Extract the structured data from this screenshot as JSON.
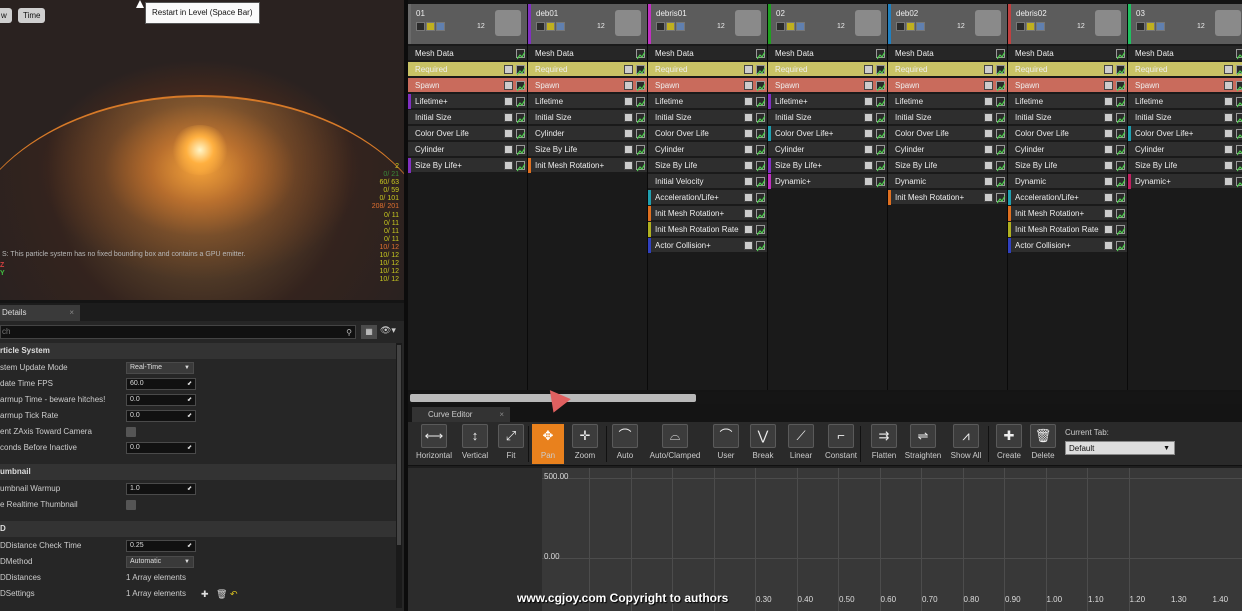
{
  "viewport": {
    "buttons": [
      "w",
      "Time"
    ],
    "tooltip": "Restart in Level (Space Bar)",
    "warning": "S: This particle system has no fixed bounding box and contains a GPU emitter.",
    "axis_z": "Z",
    "axis_y": "Y",
    "stats": [
      {
        "text": "2",
        "color": "#c8c820"
      },
      {
        "text": "0/ 21",
        "color": "#3a8a3a"
      },
      {
        "text": "60/ 63",
        "color": "#c8c820"
      },
      {
        "text": "0/ 59",
        "color": "#c8c820"
      },
      {
        "text": "0/ 101",
        "color": "#c8c820"
      },
      {
        "text": "208/ 201",
        "color": "#e07030"
      },
      {
        "text": "0/ 11",
        "color": "#c8c820"
      },
      {
        "text": "0/ 11",
        "color": "#c8c820"
      },
      {
        "text": "0/ 11",
        "color": "#c8c820"
      },
      {
        "text": "0/ 11",
        "color": "#c8c820"
      },
      {
        "text": "10/ 12",
        "color": "#e07030"
      },
      {
        "text": "10/ 12",
        "color": "#c8c820"
      },
      {
        "text": "10/ 12",
        "color": "#c8c820"
      },
      {
        "text": "10/ 12",
        "color": "#c8c820"
      },
      {
        "text": "10/ 12",
        "color": "#c8c820"
      }
    ]
  },
  "details": {
    "tab": "Details",
    "search_placeholder": "ch",
    "sections": [
      {
        "title": "rticle System",
        "rows": [
          {
            "label": "stem Update Mode",
            "kind": "dropdown",
            "value": "Real-Time"
          },
          {
            "label": "date Time FPS",
            "kind": "number",
            "value": "60.0"
          },
          {
            "label": "armup Time - beware hitches!",
            "kind": "number",
            "value": "0.0"
          },
          {
            "label": "armup Tick Rate",
            "kind": "number",
            "value": "0.0"
          },
          {
            "label": "ent ZAxis Toward Camera",
            "kind": "check",
            "value": ""
          },
          {
            "label": "conds Before Inactive",
            "kind": "number",
            "value": "0.0"
          }
        ]
      },
      {
        "title": "umbnail",
        "rows": [
          {
            "label": "umbnail Warmup",
            "kind": "number",
            "value": "1.0"
          },
          {
            "label": "e Realtime Thumbnail",
            "kind": "check",
            "value": ""
          }
        ]
      },
      {
        "title": "D",
        "rows": [
          {
            "label": "DDistance Check Time",
            "kind": "number",
            "value": "0.25"
          },
          {
            "label": "DMethod",
            "kind": "dropdown",
            "value": "Automatic"
          },
          {
            "label": "DDistances",
            "kind": "array",
            "value": "1 Array elements"
          },
          {
            "label": "DSettings",
            "kind": "array",
            "value": "1 Array elements"
          }
        ]
      }
    ]
  },
  "emitters": [
    {
      "name": "01",
      "count": "12",
      "accent": "#6a6a6a",
      "modules": [
        {
          "label": "Mesh Data",
          "type": "plain",
          "bar": ""
        },
        {
          "label": "Required",
          "type": "req",
          "bar": ""
        },
        {
          "label": "Spawn",
          "type": "spawn",
          "bar": ""
        },
        {
          "label": "Lifetime+",
          "type": "mod",
          "bar": "#8030c0"
        },
        {
          "label": "Initial Size",
          "type": "mod",
          "bar": ""
        },
        {
          "label": "Color Over Life",
          "type": "mod",
          "bar": ""
        },
        {
          "label": "Cylinder",
          "type": "mod",
          "bar": ""
        },
        {
          "label": "Size By Life+",
          "type": "mod",
          "bar": "#8030c0"
        }
      ]
    },
    {
      "name": "deb01",
      "count": "12",
      "accent": "#8030c0",
      "modules": [
        {
          "label": "Mesh Data",
          "type": "plain",
          "bar": ""
        },
        {
          "label": "Required",
          "type": "req",
          "bar": ""
        },
        {
          "label": "Spawn",
          "type": "spawn",
          "bar": ""
        },
        {
          "label": "Lifetime",
          "type": "mod",
          "bar": ""
        },
        {
          "label": "Initial Size",
          "type": "mod",
          "bar": ""
        },
        {
          "label": "Cylinder",
          "type": "mod",
          "bar": ""
        },
        {
          "label": "Size By Life",
          "type": "mod",
          "bar": ""
        },
        {
          "label": "Init Mesh Rotation+",
          "type": "mod",
          "bar": "#e07020"
        }
      ]
    },
    {
      "name": "debris01",
      "count": "12",
      "accent": "#c030c0",
      "modules": [
        {
          "label": "Mesh Data",
          "type": "plain",
          "bar": ""
        },
        {
          "label": "Required",
          "type": "req",
          "bar": ""
        },
        {
          "label": "Spawn",
          "type": "spawn",
          "bar": ""
        },
        {
          "label": "Lifetime",
          "type": "mod",
          "bar": ""
        },
        {
          "label": "Initial Size",
          "type": "mod",
          "bar": ""
        },
        {
          "label": "Color Over Life",
          "type": "mod",
          "bar": ""
        },
        {
          "label": "Cylinder",
          "type": "mod",
          "bar": ""
        },
        {
          "label": "Size By Life",
          "type": "mod",
          "bar": ""
        },
        {
          "label": "Initial Velocity",
          "type": "mod",
          "bar": ""
        },
        {
          "label": "Acceleration/Life+",
          "type": "mod",
          "bar": "#20a0b0"
        },
        {
          "label": "Init Mesh Rotation+",
          "type": "mod",
          "bar": "#e07020"
        },
        {
          "label": "Init Mesh Rotation Rate",
          "type": "mod",
          "bar": "#b0b020"
        },
        {
          "label": "Actor Collision+",
          "type": "mod",
          "bar": "#3040c0"
        }
      ]
    },
    {
      "name": "02",
      "count": "12",
      "accent": "#20a020",
      "modules": [
        {
          "label": "Mesh Data",
          "type": "plain",
          "bar": ""
        },
        {
          "label": "Required",
          "type": "req",
          "bar": ""
        },
        {
          "label": "Spawn",
          "type": "spawn",
          "bar": ""
        },
        {
          "label": "Lifetime+",
          "type": "mod",
          "bar": "#8030c0"
        },
        {
          "label": "Initial Size",
          "type": "mod",
          "bar": ""
        },
        {
          "label": "Color Over Life+",
          "type": "mod",
          "bar": "#20a0b0"
        },
        {
          "label": "Cylinder",
          "type": "mod",
          "bar": ""
        },
        {
          "label": "Size By Life+",
          "type": "mod",
          "bar": "#8030c0"
        },
        {
          "label": "Dynamic+",
          "type": "mod",
          "bar": "#c030c0"
        }
      ]
    },
    {
      "name": "deb02",
      "count": "12",
      "accent": "#2080c0",
      "modules": [
        {
          "label": "Mesh Data",
          "type": "plain",
          "bar": ""
        },
        {
          "label": "Required",
          "type": "req",
          "bar": ""
        },
        {
          "label": "Spawn",
          "type": "spawn",
          "bar": ""
        },
        {
          "label": "Lifetime",
          "type": "mod",
          "bar": ""
        },
        {
          "label": "Initial Size",
          "type": "mod",
          "bar": ""
        },
        {
          "label": "Color Over Life",
          "type": "mod",
          "bar": ""
        },
        {
          "label": "Cylinder",
          "type": "mod",
          "bar": ""
        },
        {
          "label": "Size By Life",
          "type": "mod",
          "bar": ""
        },
        {
          "label": "Dynamic",
          "type": "mod",
          "bar": ""
        },
        {
          "label": "Init Mesh Rotation+",
          "type": "mod",
          "bar": "#e07020"
        }
      ]
    },
    {
      "name": "debris02",
      "count": "12",
      "accent": "#c04040",
      "modules": [
        {
          "label": "Mesh Data",
          "type": "plain",
          "bar": ""
        },
        {
          "label": "Required",
          "type": "req",
          "bar": ""
        },
        {
          "label": "Spawn",
          "type": "spawn",
          "bar": ""
        },
        {
          "label": "Lifetime",
          "type": "mod",
          "bar": ""
        },
        {
          "label": "Initial Size",
          "type": "mod",
          "bar": ""
        },
        {
          "label": "Color Over Life",
          "type": "mod",
          "bar": ""
        },
        {
          "label": "Cylinder",
          "type": "mod",
          "bar": ""
        },
        {
          "label": "Size By Life",
          "type": "mod",
          "bar": ""
        },
        {
          "label": "Dynamic",
          "type": "mod",
          "bar": ""
        },
        {
          "label": "Acceleration/Life+",
          "type": "mod",
          "bar": "#20a0b0"
        },
        {
          "label": "Init Mesh Rotation+",
          "type": "mod",
          "bar": "#e07020"
        },
        {
          "label": "Init Mesh Rotation Rate",
          "type": "mod",
          "bar": "#b0b020"
        },
        {
          "label": "Actor Collision+",
          "type": "mod",
          "bar": "#3040c0"
        }
      ]
    },
    {
      "name": "03",
      "count": "12",
      "accent": "#20c060",
      "modules": [
        {
          "label": "Mesh Data",
          "type": "plain",
          "bar": ""
        },
        {
          "label": "Required",
          "type": "req",
          "bar": ""
        },
        {
          "label": "Spawn",
          "type": "spawn",
          "bar": ""
        },
        {
          "label": "Lifetime",
          "type": "mod",
          "bar": ""
        },
        {
          "label": "Initial Size",
          "type": "mod",
          "bar": ""
        },
        {
          "label": "Color Over Life+",
          "type": "mod",
          "bar": "#20a0b0"
        },
        {
          "label": "Cylinder",
          "type": "mod",
          "bar": ""
        },
        {
          "label": "Size By Life",
          "type": "mod",
          "bar": ""
        },
        {
          "label": "Dynamic+",
          "type": "mod",
          "bar": "#c02060"
        }
      ]
    }
  ],
  "curve_editor": {
    "tab": "Curve Editor",
    "tools": [
      {
        "label": "Horizontal",
        "icon": "horizontal-icon",
        "glyph": "⟷"
      },
      {
        "label": "Vertical",
        "icon": "vertical-icon",
        "glyph": "↕"
      },
      {
        "label": "Fit",
        "icon": "fit-icon",
        "glyph": "⤢"
      },
      {
        "label": "Pan",
        "icon": "pan-icon",
        "glyph": "✥",
        "active": true
      },
      {
        "label": "Zoom",
        "icon": "zoom-icon",
        "glyph": "✛"
      },
      {
        "label": "Auto",
        "icon": "auto-tangent-icon",
        "glyph": "⌒"
      },
      {
        "label": "Auto/Clamped",
        "icon": "auto-clamped-icon",
        "glyph": "⌓"
      },
      {
        "label": "User",
        "icon": "user-tangent-icon",
        "glyph": "⌒"
      },
      {
        "label": "Break",
        "icon": "break-tangent-icon",
        "glyph": "⋁"
      },
      {
        "label": "Linear",
        "icon": "linear-icon",
        "glyph": "⟋"
      },
      {
        "label": "Constant",
        "icon": "constant-icon",
        "glyph": "⌐"
      },
      {
        "label": "Flatten",
        "icon": "flatten-icon",
        "glyph": "⇉"
      },
      {
        "label": "Straighten",
        "icon": "straighten-icon",
        "glyph": "⇌"
      },
      {
        "label": "Show All",
        "icon": "show-all-icon",
        "glyph": "⩘"
      },
      {
        "label": "Create",
        "icon": "create-icon",
        "glyph": "✚"
      },
      {
        "label": "Delete",
        "icon": "delete-icon",
        "glyph": "🗑"
      }
    ],
    "current_tab_label": "Current Tab:",
    "current_tab_value": "Default",
    "y_labels": [
      "500.00",
      "0.00"
    ],
    "x_labels": [
      "0.30",
      "0.40",
      "0.50",
      "0.60",
      "0.70",
      "0.80",
      "0.90",
      "1.00",
      "1.10",
      "1.20",
      "1.30",
      "1.40"
    ]
  },
  "watermark": "www.cgjoy.com Copyright to authors"
}
